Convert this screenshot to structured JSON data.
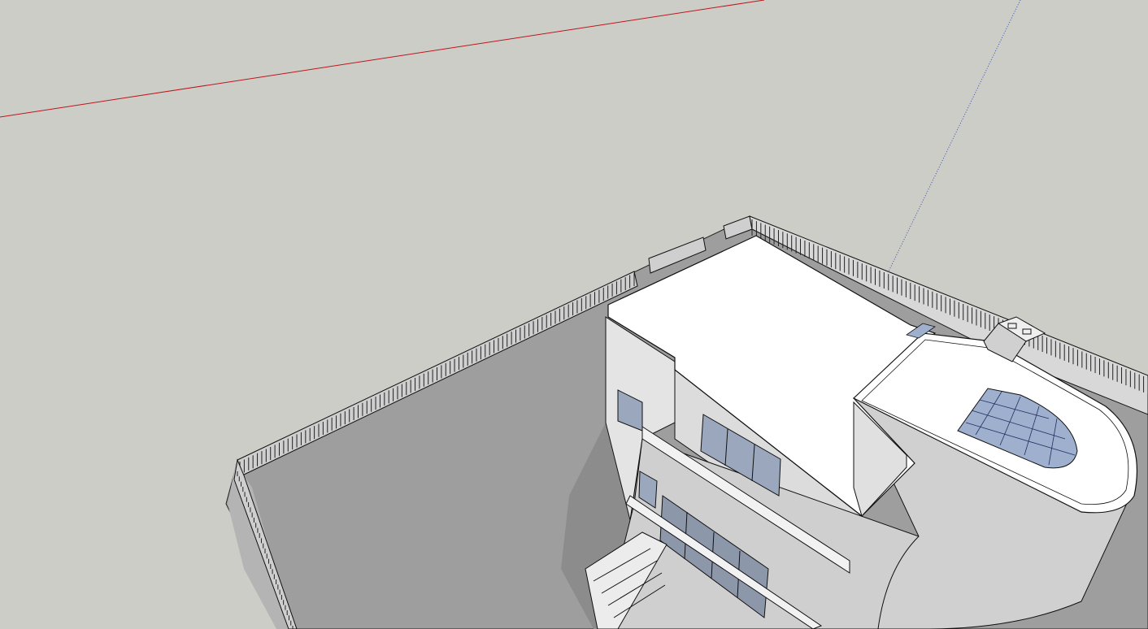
{
  "app": {
    "view": "3d-model-viewport"
  },
  "colors": {
    "background": "#cdcdc8",
    "ground_plane": "#9e9e9e",
    "ground_shadow": "#8a8a8a",
    "roof": "#ffffff",
    "wall_light": "#e6e6e6",
    "wall_mid": "#d4d4d4",
    "wall_dark": "#b7b7b7",
    "glass": "#9fb0cf",
    "edge": "#111111",
    "axis_red": "#c0151b",
    "axis_blue": "#3a4fa8"
  },
  "scene": {
    "objects": [
      "ground-plane",
      "perimeter-fence",
      "villa-building",
      "skylight",
      "roof-vent",
      "entrance-stair"
    ]
  }
}
